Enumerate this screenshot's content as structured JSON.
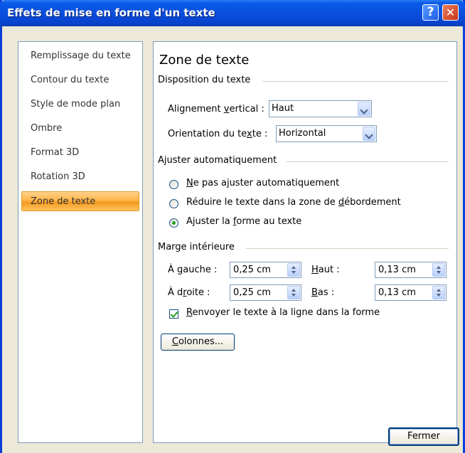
{
  "window": {
    "title": "Effets de mise en forme d'un texte",
    "help_glyph": "?",
    "close_glyph": "✕"
  },
  "nav": {
    "items": [
      {
        "label": "Remplissage du texte"
      },
      {
        "label": "Contour du texte"
      },
      {
        "label": "Style de mode plan"
      },
      {
        "label": "Ombre"
      },
      {
        "label": "Format 3D"
      },
      {
        "label": "Rotation 3D"
      },
      {
        "label": "Zone de texte",
        "selected": true
      }
    ]
  },
  "panel": {
    "heading": "Zone de texte",
    "layout": {
      "section_label": "Disposition du texte",
      "vertical_alignment": {
        "label_before": "Alignement ",
        "label_accel": "v",
        "label_after": "ertical :",
        "value": "Haut"
      },
      "orientation": {
        "label_before": "Orientation du te",
        "label_accel": "x",
        "label_after": "te :",
        "value": "Horizontal"
      }
    },
    "autofit": {
      "section_label": "Ajuster automatiquement",
      "options": [
        {
          "before": "",
          "accel": "N",
          "after": "e pas ajuster automatiquement",
          "selected": false
        },
        {
          "before": "Réduire le texte dans la zone de ",
          "accel": "d",
          "after": "ébordement",
          "selected": false
        },
        {
          "before": "Ajuster la ",
          "accel": "f",
          "after": "orme au texte",
          "selected": true
        }
      ]
    },
    "margins": {
      "section_label": "Marge intérieure",
      "left": {
        "before": "À ",
        "accel": "g",
        "after": "auche :",
        "value": "0,25 cm"
      },
      "right": {
        "before": "À d",
        "accel": "r",
        "after": "oite :",
        "value": "0,25 cm"
      },
      "top": {
        "before": "",
        "accel": "H",
        "after": "aut :",
        "value": "0,13 cm"
      },
      "bottom": {
        "before": "",
        "accel": "B",
        "after": "as :",
        "value": "0,13 cm"
      },
      "wrap": {
        "before": "",
        "accel": "R",
        "after": "envoyer le texte à la ligne dans la forme",
        "checked": true
      }
    },
    "columns_button": {
      "before": "",
      "accel": "C",
      "after": "olonnes..."
    }
  },
  "footer": {
    "close_button": "Fermer"
  },
  "colors": {
    "titlebar": "#0a4fde",
    "selected_item": "#ffb44a",
    "radio_dot": "#21a121"
  }
}
